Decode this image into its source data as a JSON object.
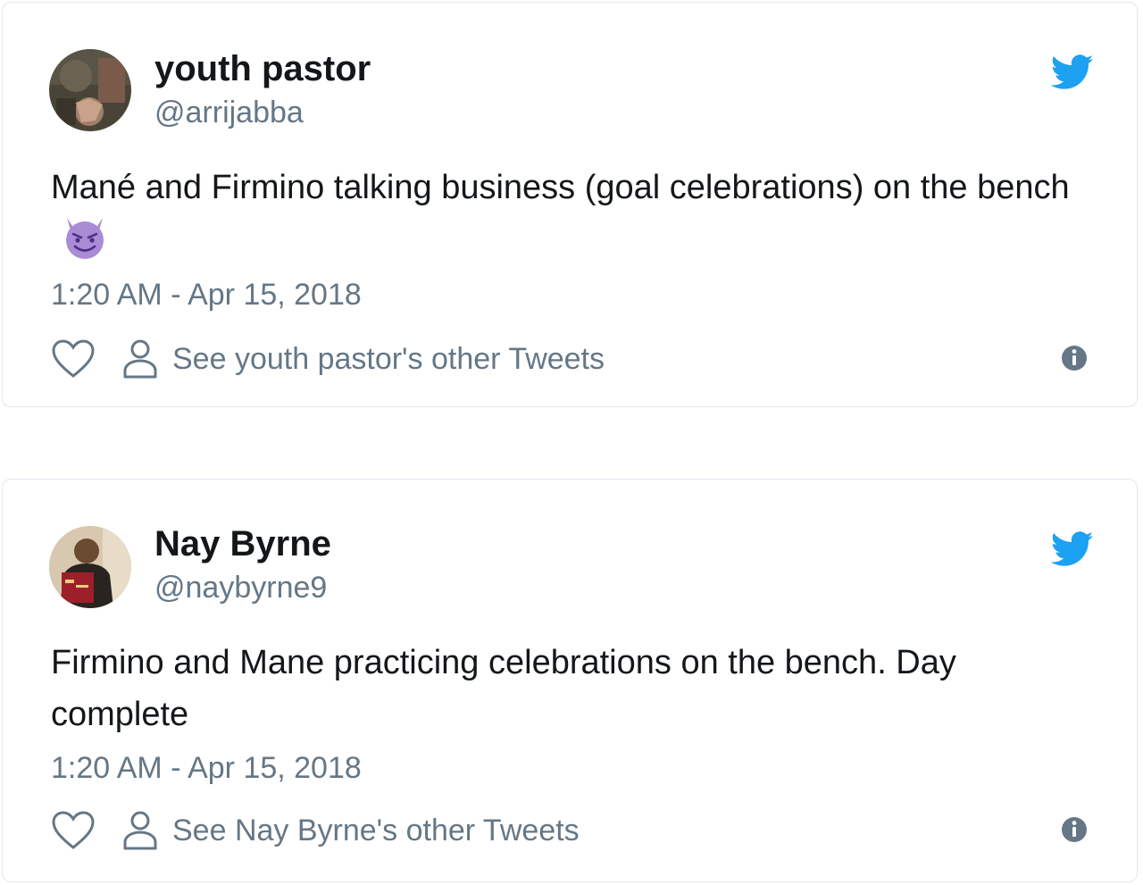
{
  "colors": {
    "twitter_blue": "#1da1f2",
    "text_primary": "#14171a",
    "text_secondary": "#657786",
    "border": "#e1e8ed",
    "emoji_purple": "#a98bd6"
  },
  "tweets": [
    {
      "display_name": "youth pastor",
      "handle": "@arrijabba",
      "text": "Mané and Firmino talking business (goal celebrations) on the bench",
      "emoji": "smiling-imp-emoji",
      "timestamp": "1:20 AM - Apr 15, 2018",
      "other_tweets_label": "See youth pastor's other Tweets",
      "icons": [
        "twitter-bird-icon",
        "heart-icon",
        "person-icon",
        "info-icon"
      ]
    },
    {
      "display_name": "Nay Byrne",
      "handle": "@naybyrne9",
      "text": "Firmino and Mane practicing celebrations on the bench. Day complete",
      "timestamp": "1:20 AM - Apr 15, 2018",
      "other_tweets_label": "See Nay Byrne's other Tweets",
      "icons": [
        "twitter-bird-icon",
        "heart-icon",
        "person-icon",
        "info-icon"
      ]
    }
  ]
}
